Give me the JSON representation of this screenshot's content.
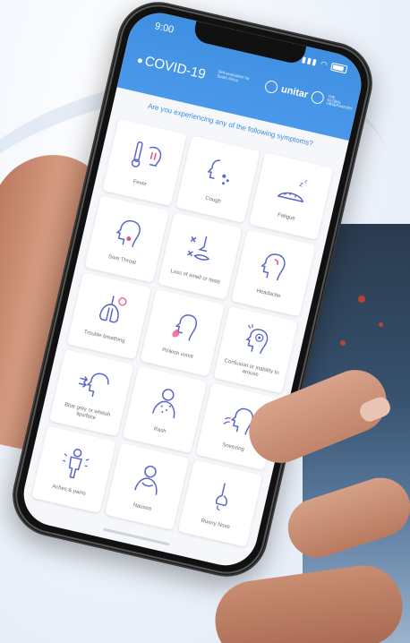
{
  "status_bar": {
    "time": "9:00"
  },
  "app": {
    "title": "COVID-19",
    "subtitle": "Self-evaluation for South Africa",
    "partner_unitar": "unitar",
    "partner_small": "THE GLOBAL OBSERVATORY"
  },
  "question": "Are you experiencing any of the following symptoms?",
  "symptoms": [
    {
      "label": "Fever",
      "icon": "fever-icon"
    },
    {
      "label": "Cough",
      "icon": "cough-icon"
    },
    {
      "label": "Fatigue",
      "icon": "fatigue-icon"
    },
    {
      "label": "Sore Throat",
      "icon": "sore-throat-icon"
    },
    {
      "label": "Loss of smell or taste",
      "icon": "loss-of-smell-icon"
    },
    {
      "label": "Headache",
      "icon": "headache-icon"
    },
    {
      "label": "Trouble breathing",
      "icon": "trouble-breathing-icon"
    },
    {
      "label": "Pinkish vomit",
      "icon": "vomit-icon"
    },
    {
      "label": "Confusion or inability to arouse",
      "icon": "confusion-icon"
    },
    {
      "label": "Blue grey or whitish lips/face",
      "icon": "blue-lips-icon"
    },
    {
      "label": "Rash",
      "icon": "rash-icon"
    },
    {
      "label": "Sneezing",
      "icon": "sneezing-icon"
    },
    {
      "label": "Aches & pains",
      "icon": "aches-icon"
    },
    {
      "label": "Nausea",
      "icon": "nausea-icon"
    },
    {
      "label": "Runny Nose",
      "icon": "runny-nose-icon"
    }
  ],
  "colors": {
    "header": "#4a98ea",
    "accent": "#3a8be0",
    "icon_stroke": "#5a66c8",
    "icon_accent": "#e0508a"
  }
}
